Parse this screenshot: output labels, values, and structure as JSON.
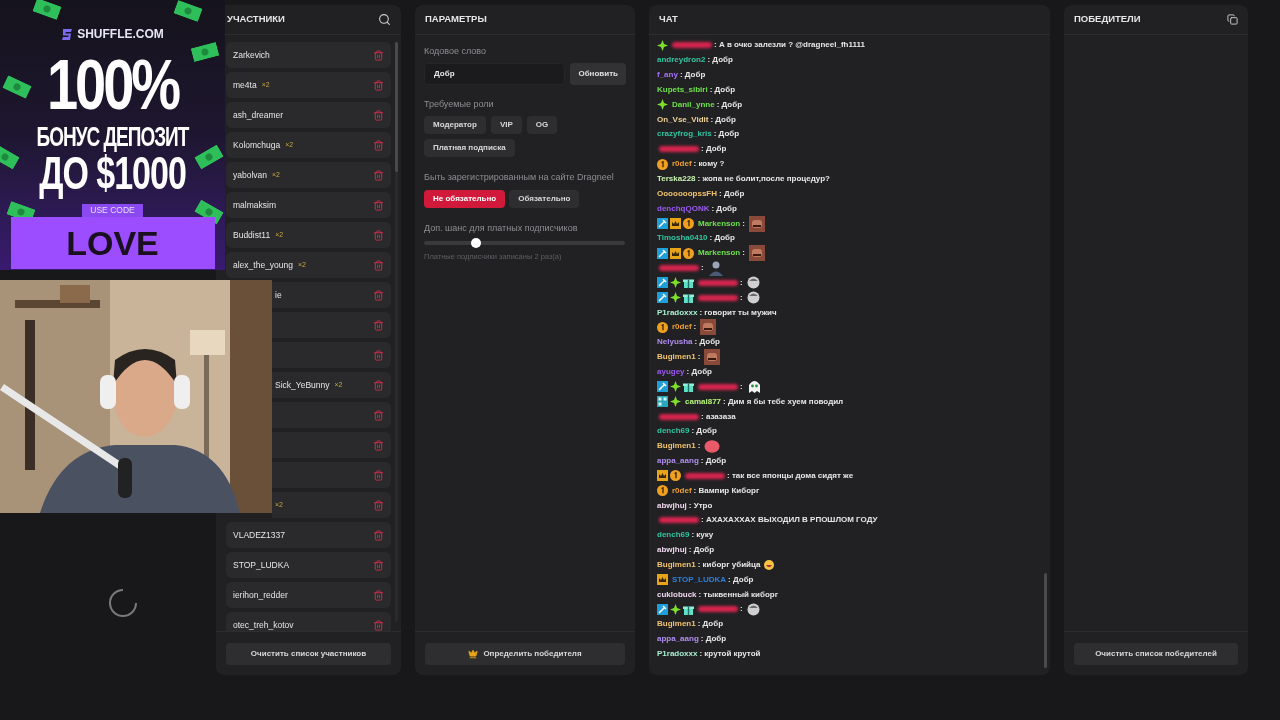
{
  "ad": {
    "brand": "SHUFFLE.COM",
    "headline": "100%",
    "line_1": "БОНУС ДЕПОЗИТ",
    "line_2": "ДО $1000",
    "code_label": "USE CODE",
    "code": "LOVE"
  },
  "participants": {
    "title": "УЧАСТНИКИ",
    "items": [
      {
        "kind": "full",
        "name": "Zarkevich"
      },
      {
        "kind": "full",
        "name": "me4ta",
        "multiplier": "×2"
      },
      {
        "kind": "full",
        "name": "ash_dreamer"
      },
      {
        "kind": "full",
        "name": "Kolomchuga",
        "multiplier": "×2"
      },
      {
        "kind": "full",
        "name": "yabolvan",
        "multiplier": "×2"
      },
      {
        "kind": "full",
        "name": "malmaksim"
      },
      {
        "kind": "full",
        "name": "Buddist11",
        "multiplier": "×2"
      },
      {
        "kind": "full",
        "name": "alex_the_young",
        "multiplier": "×2"
      },
      {
        "kind": "cut",
        "name": "ie"
      },
      {
        "kind": "covered"
      },
      {
        "kind": "covered"
      },
      {
        "kind": "cut",
        "name": "Sick_YeBunny",
        "multiplier": "×2"
      },
      {
        "kind": "covered"
      },
      {
        "kind": "covered"
      },
      {
        "kind": "covered"
      },
      {
        "kind": "cut",
        "multiplier": "×2"
      },
      {
        "kind": "full",
        "name": "VLADEZ1337"
      },
      {
        "kind": "full",
        "name": "STOP_LUDKA"
      },
      {
        "kind": "full",
        "name": "ierihon_redder"
      },
      {
        "kind": "full",
        "name": "otec_treh_kotov"
      }
    ],
    "clear_button": "Очистить список участников"
  },
  "parameters": {
    "title": "ПАРАМЕТРЫ",
    "code_word_label": "Кодовое слово",
    "code_word_value": "Добр",
    "update_button": "Обновить",
    "roles_label": "Требуемые роли",
    "roles": [
      {
        "label": "Модератор",
        "selected": false
      },
      {
        "label": "VIP",
        "selected": false
      },
      {
        "label": "OG",
        "selected": false
      },
      {
        "label": "Платная подписка",
        "selected": false
      }
    ],
    "registration_label": "Быть зарегистрированным на сайте Dragneel",
    "registration_options": [
      {
        "label": "Не обязательно",
        "selected": true
      },
      {
        "label": "Обязательно",
        "selected": false
      }
    ],
    "chance_label": "Доп. шанс для платных подписчиков",
    "chance": {
      "level": 0.26
    },
    "chance_hint": "Платные подписчики записаны 2 раз(а)",
    "pick_button": "Определить победителя"
  },
  "chat": {
    "title": "ЧАТ",
    "messages": [
      {
        "badges": [
          {
            "kind": "sparkle"
          }
        ],
        "color": "#d8244f",
        "text": ": А в очко залезли ? @dragneel_fh1111"
      },
      {
        "user": "andreydron2",
        "color": "#2ec4a0",
        "text": ": Добр"
      },
      {
        "user": "f_any",
        "color": "#a970ff",
        "text": ": Добр"
      },
      {
        "user": "Kupets_sibiri",
        "color": "#6fe04a",
        "text": ": Добр"
      },
      {
        "badges": [
          {
            "kind": "sparkle"
          }
        ],
        "user": "Danil_ynne",
        "color": "#6fe04a",
        "text": ": Добр"
      },
      {
        "user": "On_Vse_Vidit",
        "color": "#f2d29a",
        "text": ": Добр"
      },
      {
        "user": "crazyfrog_kris",
        "color": "#2ec4a0",
        "text": ": Добр"
      },
      {
        "color": "#d8244f",
        "text": ": Добр"
      },
      {
        "badges": [
          {
            "kind": "sub"
          }
        ],
        "user": "r0def",
        "color": "#f0a030",
        "text": ": кому ?"
      },
      {
        "user": "Terska228",
        "color": "#c8f5b0",
        "text": ": жопа не болит,после процедур?"
      },
      {
        "user": "OoooooopssFH",
        "color": "#f2c36a",
        "text": ": Добр"
      },
      {
        "user": "denchqQONK",
        "color": "#9b59f0",
        "text": ": Добр"
      },
      {
        "badges": [
          {
            "kind": "mod"
          },
          {
            "kind": "crown"
          },
          {
            "kind": "sub"
          }
        ],
        "user": "Markenson",
        "color": "#6fe04a",
        "text": ":",
        "emote": {
          "kind": "face"
        }
      },
      {
        "user": "Timosha0410",
        "color": "#2ec4a0",
        "text": ": Добр"
      },
      {
        "badges": [
          {
            "kind": "mod"
          },
          {
            "kind": "crown"
          },
          {
            "kind": "sub"
          }
        ],
        "user": "Markenson",
        "color": "#6fe04a",
        "text": ":",
        "emote": {
          "kind": "face"
        }
      },
      {
        "color": "#d8244f",
        "text": ":",
        "emote": {
          "kind": "person"
        }
      },
      {
        "badges": [
          {
            "kind": "mod"
          },
          {
            "kind": "sparkle"
          },
          {
            "kind": "gift"
          }
        ],
        "color": "#d8244f",
        "text": ":",
        "emote": {
          "kind": "round"
        }
      },
      {
        "badges": [
          {
            "kind": "mod"
          },
          {
            "kind": "sparkle"
          },
          {
            "kind": "gift"
          }
        ],
        "color": "#d8244f",
        "text": ":",
        "emote": {
          "kind": "round"
        }
      },
      {
        "user": "P1radoxxx",
        "color": "#a8f0d0",
        "text": ": говорит ты мужич"
      },
      {
        "badges": [
          {
            "kind": "sub"
          }
        ],
        "user": "r0def",
        "color": "#f0a030",
        "text": ":",
        "emote": {
          "kind": "face"
        }
      },
      {
        "user": "Nelyusha",
        "color": "#b08df0",
        "text": ": Добр"
      },
      {
        "user": "Bugimen1",
        "color": "#f2c36a",
        "text": ":",
        "emote": {
          "kind": "face"
        }
      },
      {
        "user": "ayugey",
        "color": "#9b59f0",
        "text": ": Добр"
      },
      {
        "badges": [
          {
            "kind": "mod"
          },
          {
            "kind": "sparkle"
          },
          {
            "kind": "gift"
          }
        ],
        "color": "#d8244f",
        "text": ":",
        "emote": {
          "kind": "ghost"
        }
      },
      {
        "badges": [
          {
            "kind": "grid"
          },
          {
            "kind": "sparkle"
          }
        ],
        "user": "camal877",
        "color": "#b8f57a",
        "text": ": Дим я бы тебе хуем поводил"
      },
      {
        "color": "#d8244f",
        "text": ": азазаза"
      },
      {
        "user": "dench69",
        "color": "#2ec4a0",
        "text": ": Добр"
      },
      {
        "user": "Bugimen1",
        "color": "#f2c36a",
        "text": ":",
        "emote": {
          "kind": "blob"
        }
      },
      {
        "user": "appa_aang",
        "color": "#b08df0",
        "text": ": Добр"
      },
      {
        "badges": [
          {
            "kind": "crown"
          },
          {
            "kind": "sub"
          }
        ],
        "color": "#d8244f",
        "text": ": так все японцы дома сидят же"
      },
      {
        "badges": [
          {
            "kind": "sub"
          }
        ],
        "user": "r0def",
        "color": "#f0a030",
        "text": ": Вампир Киборг"
      },
      {
        "user": "abwjhuj",
        "color": "#f0d6f0",
        "text": ": Утро"
      },
      {
        "color": "#d8244f",
        "text": ": АХАХАХХАХ ВЫХОДИЛ В РПОШЛОМ ГОДУ"
      },
      {
        "user": "dench69",
        "color": "#2ec4a0",
        "text": ": куку"
      },
      {
        "user": "abwjhuj",
        "color": "#f0d6f0",
        "text": ": Добр"
      },
      {
        "user": "Bugimen1",
        "color": "#f2c36a",
        "text": ": киборг убийца",
        "emote": {
          "kind": "laugh"
        }
      },
      {
        "badges": [
          {
            "kind": "crown"
          }
        ],
        "user": "STOP_LUDKA",
        "color": "#2e7fd8",
        "text": ": Добр"
      },
      {
        "user": "cuklobuck",
        "color": "#f0d6f0",
        "text": ": тыквенный киборг"
      },
      {
        "badges": [
          {
            "kind": "mod"
          },
          {
            "kind": "sparkle"
          },
          {
            "kind": "gift"
          }
        ],
        "color": "#d8244f",
        "text": ":",
        "emote": {
          "kind": "round"
        }
      },
      {
        "user": "Bugimen1",
        "color": "#f2c36a",
        "text": ": Добр"
      },
      {
        "user": "appa_aang",
        "color": "#b08df0",
        "text": ": Добр"
      },
      {
        "user": "P1radoxxx",
        "color": "#a8f0d0",
        "text": ": крутой крутой"
      }
    ]
  },
  "winners": {
    "title": "ПОБЕДИТЕЛИ",
    "clear_button": "Очистить список победителей"
  }
}
